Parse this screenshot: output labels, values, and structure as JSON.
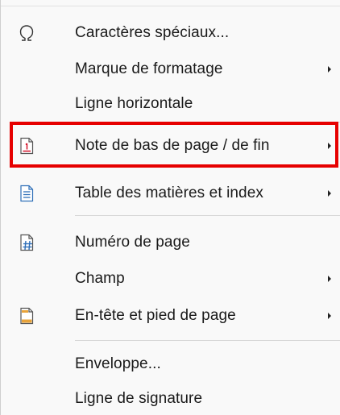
{
  "menu": {
    "items": [
      {
        "label": "Caractères spéciaux...",
        "icon": "omega-icon",
        "submenu": false
      },
      {
        "label": "Marque de formatage",
        "icon": null,
        "submenu": true
      },
      {
        "label": "Ligne horizontale",
        "icon": null,
        "submenu": false
      },
      {
        "label": "Note de bas de page / de fin",
        "icon": "footnote-icon",
        "submenu": true
      },
      {
        "label": "Table des matières et index",
        "icon": "table-of-contents-icon",
        "submenu": true
      },
      {
        "label": "Numéro de page",
        "icon": "page-number-icon",
        "submenu": false
      },
      {
        "label": "Champ",
        "icon": null,
        "submenu": true
      },
      {
        "label": "En-tête et pied de page",
        "icon": "header-footer-icon",
        "submenu": true
      },
      {
        "label": "Enveloppe...",
        "icon": null,
        "submenu": false
      },
      {
        "label": "Ligne de signature",
        "icon": null,
        "submenu": false
      }
    ]
  },
  "colors": {
    "highlight_border": "#e60000",
    "menu_background": "#f9f9f9",
    "icon_blue": "#2f6fb8",
    "icon_orange": "#e8a33a",
    "icon_red": "#d0021b"
  }
}
